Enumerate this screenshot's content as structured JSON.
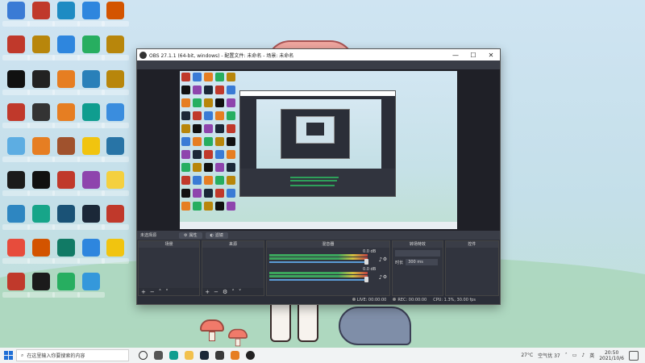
{
  "colors": {
    "obs_bg": "#2b2e38",
    "obs_panel": "#31343e",
    "meter_green": "#3ca55c",
    "windows_blue": "#1f6fd6"
  },
  "desktop": {
    "icons": [
      {
        "label": "",
        "icon": "app-icon",
        "color": "#3a7bd5"
      },
      {
        "label": "",
        "icon": "apex-icon",
        "color": "#c0392b"
      },
      {
        "label": "",
        "icon": "wegame-icon",
        "color": "#1e8bc3"
      },
      {
        "label": "",
        "icon": "network-icon",
        "color": "#2e86de"
      },
      {
        "label": "",
        "icon": "game-icon",
        "color": "#d35400"
      },
      {
        "label": "",
        "icon": "apex-icon",
        "color": "#c0392b"
      },
      {
        "label": "",
        "icon": "lol-icon",
        "color": "#b8860b"
      },
      {
        "label": "",
        "icon": "network-icon",
        "color": "#2e86de"
      },
      {
        "label": "",
        "icon": "xbox-icon",
        "color": "#27ae60"
      },
      {
        "label": "",
        "icon": "lol-icon",
        "color": "#b8860b"
      },
      {
        "label": "",
        "icon": "bf-icon",
        "color": "#111111"
      },
      {
        "label": "",
        "icon": "logitech-icon",
        "color": "#222222"
      },
      {
        "label": "",
        "icon": "game-icon",
        "color": "#e67e22"
      },
      {
        "label": "",
        "icon": "network-icon",
        "color": "#2980b9"
      },
      {
        "label": "",
        "icon": "lol-icon",
        "color": "#b8860b"
      },
      {
        "label": "",
        "icon": "app-icon",
        "color": "#c0392b"
      },
      {
        "label": "",
        "icon": "obs-icon",
        "color": "#333333"
      },
      {
        "label": "",
        "icon": "game-icon",
        "color": "#e67e22"
      },
      {
        "label": "",
        "icon": "edge-icon",
        "color": "#0f9d8f"
      },
      {
        "label": "",
        "icon": "app-icon",
        "color": "#3a8dde"
      },
      {
        "label": "",
        "icon": "folder-icon",
        "color": "#5dade2"
      },
      {
        "label": "",
        "icon": "origin-icon",
        "color": "#e67e22"
      },
      {
        "label": "",
        "icon": "rainbow-icon",
        "color": "#a0522d"
      },
      {
        "label": "",
        "icon": "app-icon",
        "color": "#f1c40f"
      },
      {
        "label": "",
        "icon": "gear-icon",
        "color": "#2874a6"
      },
      {
        "label": "",
        "icon": "predator-icon",
        "color": "#1b1b1b"
      },
      {
        "label": "",
        "icon": "blackdesert-icon",
        "color": "#111111"
      },
      {
        "label": "",
        "icon": "user-icon",
        "color": "#c0392b"
      },
      {
        "label": "",
        "icon": "wallpaper-icon",
        "color": "#8e44ad"
      },
      {
        "label": "",
        "icon": "app-icon",
        "color": "#f4d03f"
      },
      {
        "label": "",
        "icon": "app-icon",
        "color": "#2e86c1"
      },
      {
        "label": "",
        "icon": "app-icon",
        "color": "#17a589"
      },
      {
        "label": "",
        "icon": "gl-icon",
        "color": "#1a5276"
      },
      {
        "label": "",
        "icon": "steam-icon",
        "color": "#1b2838"
      },
      {
        "label": "",
        "icon": "app-icon",
        "color": "#c0392b"
      },
      {
        "label": "",
        "icon": "wps-icon",
        "color": "#e74c3c"
      },
      {
        "label": "",
        "icon": "app-icon",
        "color": "#d35400"
      },
      {
        "label": "",
        "icon": "app-icon",
        "color": "#117a65"
      },
      {
        "label": "",
        "icon": "app-icon",
        "color": "#2e86de"
      },
      {
        "label": "",
        "icon": "app-icon",
        "color": "#f1c40f"
      },
      {
        "label": "",
        "icon": "app-icon",
        "color": "#c0392b"
      },
      {
        "label": "",
        "icon": "app-icon",
        "color": "#1b1b1b"
      },
      {
        "label": "",
        "icon": "app-icon",
        "color": "#27ae60"
      },
      {
        "label": "",
        "icon": "app-icon",
        "color": "#3498db"
      }
    ]
  },
  "obs": {
    "title": "OBS 27.1.1 (64-bit, windows) - 配置文件: 未命名 - 场景: 未命名",
    "win_minimize": "—",
    "win_maximize": "☐",
    "win_close": "✕",
    "menu": [],
    "status_strip": {
      "label": "未选择源",
      "properties": "属性",
      "filters": "滤镜"
    },
    "docks": {
      "scenes": {
        "title": "场景",
        "items": []
      },
      "sources": {
        "title": "来源",
        "items": []
      },
      "mixer": {
        "title": "混音器",
        "channels": [
          {
            "name": "",
            "db": "0.0 dB"
          },
          {
            "name": "",
            "db": "0.0 dB"
          }
        ]
      },
      "transitions": {
        "title": "转场特效",
        "type": "",
        "duration_label": "时长",
        "duration_value": "300 ms"
      },
      "controls": {
        "title": "控件",
        "buttons": []
      }
    },
    "statusbar": {
      "live": "LIVE: 00:00:00",
      "rec": "REC: 00:00:00",
      "cpu": "CPU: 1.3%, 30.00 fps"
    }
  },
  "taskbar": {
    "search_placeholder": "在这里输入你要搜索的内容",
    "tray": {
      "weather": "27°C",
      "air": "空气优 37",
      "lang": "英",
      "time": "20:50",
      "date": "2021/10/6"
    }
  }
}
